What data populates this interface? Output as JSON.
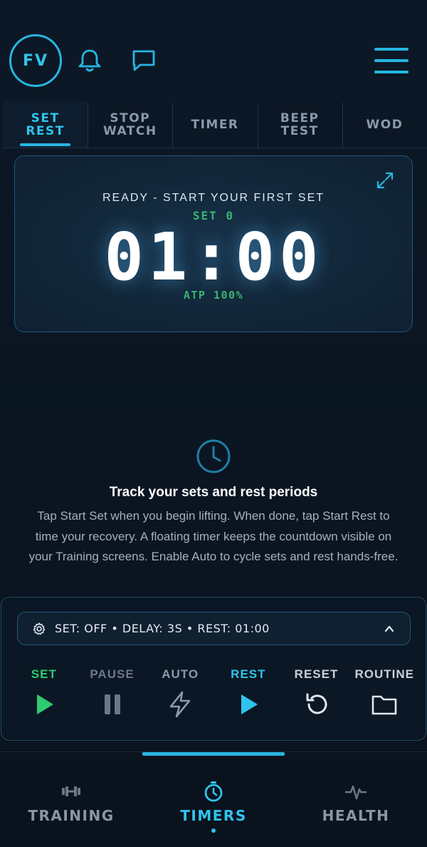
{
  "header": {
    "avatar_initials": "FV",
    "icons": [
      "bell-icon",
      "chat-icon",
      "menu-icon"
    ]
  },
  "tabs": [
    {
      "label": "SET\nREST",
      "active": true
    },
    {
      "label": "STOP\nWATCH",
      "active": false
    },
    {
      "label": "TIMER",
      "active": false
    },
    {
      "label": "BEEP\nTEST",
      "active": false
    },
    {
      "label": "WOD",
      "active": false
    }
  ],
  "timer": {
    "status": "READY - START YOUR FIRST SET",
    "set_label": "SET 0",
    "time": "01:00",
    "atp": "ATP 100%"
  },
  "info": {
    "title": "Track your sets and rest periods",
    "text": "Tap Start Set when you begin lifting. When done, tap Start Rest to time your recovery. A floating timer keeps the countdown visible on your Training screens. Enable Auto to cycle sets and rest hands-free."
  },
  "settings": {
    "summary": "SET: OFF • DELAY: 3S • REST: 01:00"
  },
  "controls": {
    "set": "SET",
    "pause": "PAUSE",
    "auto": "AUTO",
    "rest": "REST",
    "reset": "RESET",
    "routine": "ROUTINE"
  },
  "nav": {
    "training": "TRAINING",
    "timers": "TIMERS",
    "health": "HEALTH",
    "active": "timers"
  },
  "colors": {
    "accent": "#27b6e0",
    "green": "#2ecc71",
    "muted": "#8a96a4",
    "background": "#0c1826"
  }
}
